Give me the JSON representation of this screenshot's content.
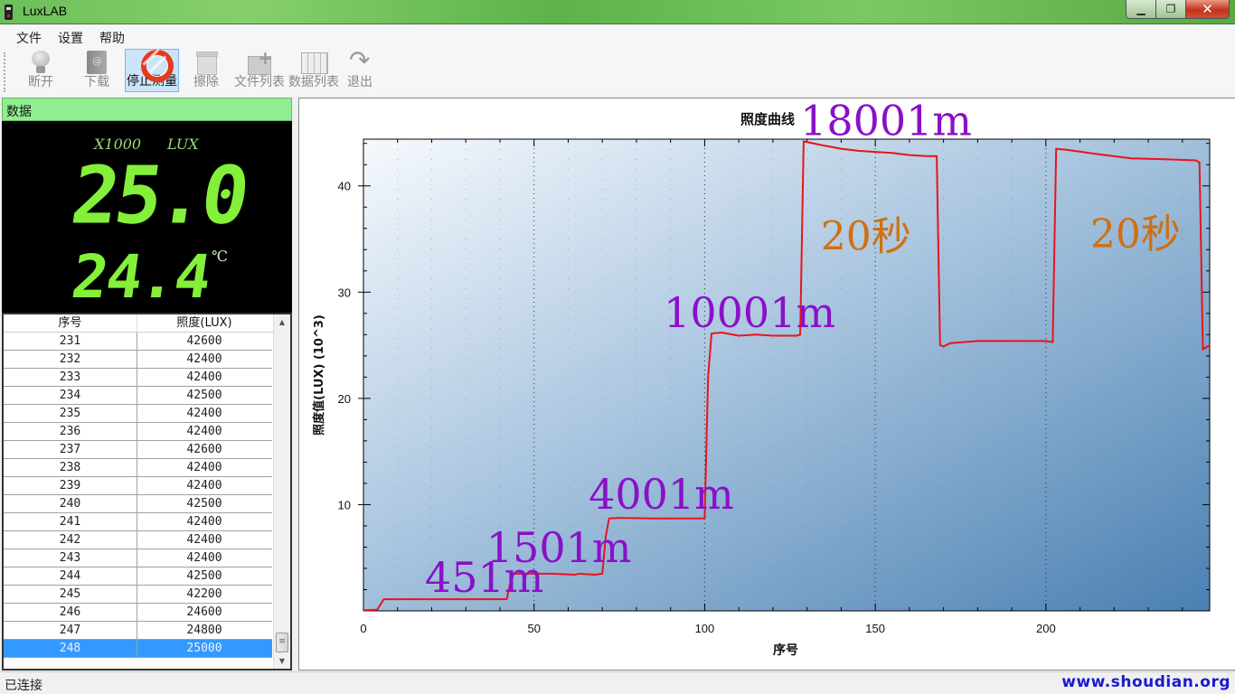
{
  "window": {
    "title": "LuxLAB",
    "controls": [
      "minimize",
      "restore",
      "close"
    ]
  },
  "menu": [
    {
      "label": "文件"
    },
    {
      "label": "设置"
    },
    {
      "label": "帮助"
    }
  ],
  "toolbar": [
    {
      "label": "断开",
      "icon": "bulb-icon",
      "enabled": false,
      "active": false
    },
    {
      "label": "下载",
      "icon": "address-book-icon",
      "enabled": false,
      "active": false
    },
    {
      "label": "停止测量",
      "icon": "lifebuoy-icon",
      "enabled": true,
      "active": true
    },
    {
      "label": "擦除",
      "icon": "recycle-bin-icon",
      "enabled": false,
      "active": false
    },
    {
      "label": "文件列表",
      "icon": "folder-add-icon",
      "enabled": false,
      "active": false
    },
    {
      "label": "数据列表",
      "icon": "spreadsheet-icon",
      "enabled": false,
      "active": false
    },
    {
      "label": "退出",
      "icon": "redo-arrow-icon",
      "enabled": false,
      "active": false
    }
  ],
  "data_panel": {
    "header": "数据",
    "multiplier": "X1000",
    "unit": "LUX",
    "lux_reading": "25.0",
    "temperature": "24.4",
    "temp_unit": "℃",
    "display_color": "#84f03a"
  },
  "table": {
    "columns": [
      "序号",
      "照度(LUX)"
    ],
    "rows": [
      [
        "231",
        "42600"
      ],
      [
        "232",
        "42400"
      ],
      [
        "233",
        "42400"
      ],
      [
        "234",
        "42500"
      ],
      [
        "235",
        "42400"
      ],
      [
        "236",
        "42400"
      ],
      [
        "237",
        "42600"
      ],
      [
        "238",
        "42400"
      ],
      [
        "239",
        "42400"
      ],
      [
        "240",
        "42500"
      ],
      [
        "241",
        "42400"
      ],
      [
        "242",
        "42400"
      ],
      [
        "243",
        "42400"
      ],
      [
        "244",
        "42500"
      ],
      [
        "245",
        "42200"
      ],
      [
        "246",
        "24600"
      ],
      [
        "247",
        "24800"
      ],
      [
        "248",
        "25000"
      ]
    ],
    "selected_row": 17
  },
  "chart_data": {
    "type": "line",
    "title": "照度曲线",
    "xlabel": "序号",
    "ylabel": "照度值(LUX)  (10^3)",
    "xlim": [
      0,
      248
    ],
    "ylim": [
      0,
      44.4
    ],
    "xticks": [
      0,
      50,
      100,
      150,
      200
    ],
    "yticks": [
      10,
      20,
      30,
      40
    ],
    "grid": "vertical-dotted",
    "line_color": "#e8141c",
    "series": [
      {
        "name": "照度",
        "points": [
          [
            0,
            0.05
          ],
          [
            4,
            0.1
          ],
          [
            5,
            0.6
          ],
          [
            6,
            1.1
          ],
          [
            20,
            1.1
          ],
          [
            42,
            1.1
          ],
          [
            43,
            2.6
          ],
          [
            44,
            3.5
          ],
          [
            55,
            3.5
          ],
          [
            62,
            3.4
          ],
          [
            63,
            3.5
          ],
          [
            68,
            3.4
          ],
          [
            70,
            3.5
          ],
          [
            71,
            7.0
          ],
          [
            72,
            8.7
          ],
          [
            75,
            8.75
          ],
          [
            85,
            8.7
          ],
          [
            100,
            8.7
          ],
          [
            101,
            22.0
          ],
          [
            102,
            26.1
          ],
          [
            105,
            26.2
          ],
          [
            110,
            25.9
          ],
          [
            115,
            26.0
          ],
          [
            120,
            25.9
          ],
          [
            127,
            25.9
          ],
          [
            128,
            26.0
          ],
          [
            129,
            44.2
          ],
          [
            135,
            43.8
          ],
          [
            140,
            43.5
          ],
          [
            145,
            43.3
          ],
          [
            150,
            43.2
          ],
          [
            155,
            43.1
          ],
          [
            160,
            42.9
          ],
          [
            165,
            42.8
          ],
          [
            168,
            42.8
          ],
          [
            169,
            25.0
          ],
          [
            170,
            24.9
          ],
          [
            172,
            25.2
          ],
          [
            180,
            25.4
          ],
          [
            190,
            25.4
          ],
          [
            200,
            25.4
          ],
          [
            202,
            25.3
          ],
          [
            203,
            43.5
          ],
          [
            206,
            43.4
          ],
          [
            215,
            43.0
          ],
          [
            225,
            42.6
          ],
          [
            235,
            42.5
          ],
          [
            244,
            42.4
          ],
          [
            245,
            42.2
          ],
          [
            246,
            24.6
          ],
          [
            247,
            24.8
          ],
          [
            248,
            25.0
          ]
        ]
      }
    ],
    "annotations": [
      {
        "text": "451m",
        "x": 18,
        "y": 1.8,
        "color": "#8a10c8"
      },
      {
        "text": "1501m",
        "x": 36,
        "y": 4.6,
        "color": "#8a10c8"
      },
      {
        "text": "4001m",
        "x": 66,
        "y": 9.6,
        "color": "#8a10c8"
      },
      {
        "text": "10001m",
        "x": 88,
        "y": 26.7,
        "color": "#8a10c8"
      },
      {
        "text": "18001m",
        "x": 128,
        "y": 44.8,
        "color": "#8a10c8"
      },
      {
        "text": "20秒",
        "x": 134,
        "y": 34.0,
        "color": "#d07010"
      },
      {
        "text": "20秒",
        "x": 213,
        "y": 34.2,
        "color": "#d07010"
      }
    ]
  },
  "status": {
    "text": "已连接",
    "watermark": "www.shoudian.org"
  }
}
